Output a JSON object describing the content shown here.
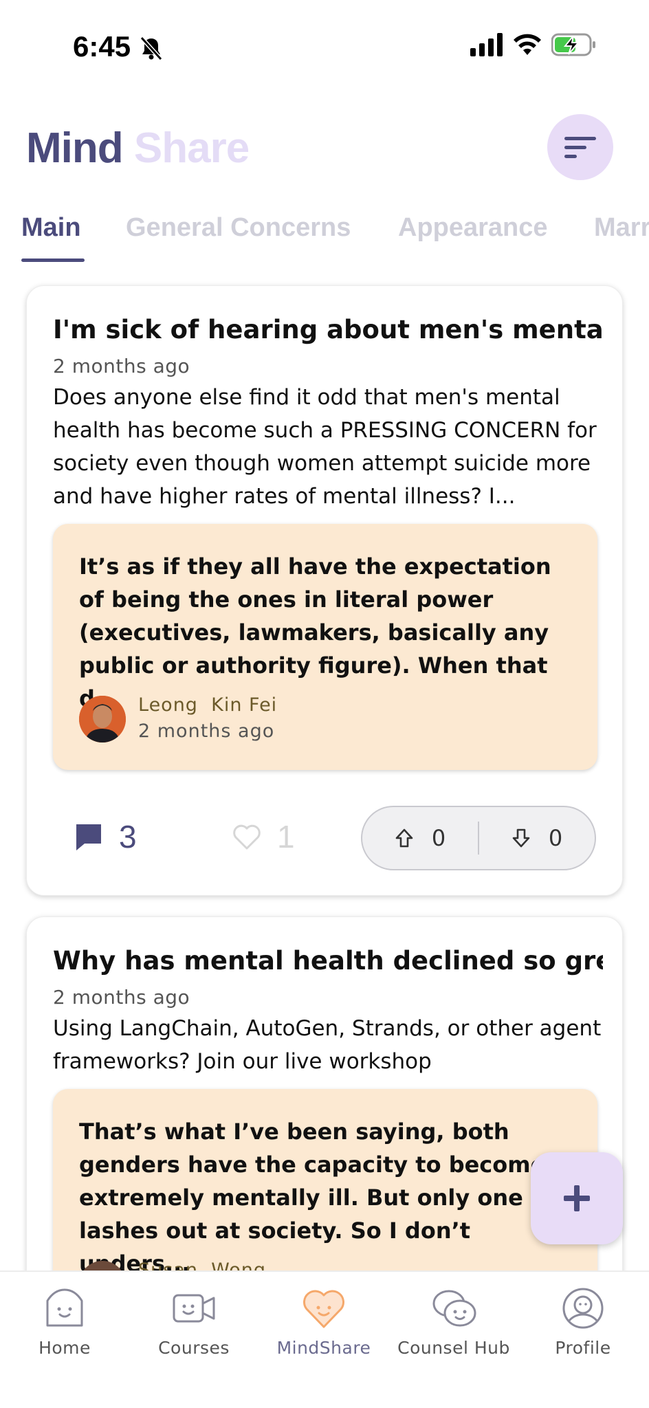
{
  "status_bar": {
    "time": "6:45",
    "icons": [
      "bell-slash-icon",
      "signal-icon",
      "wifi-icon",
      "battery-charging-icon"
    ]
  },
  "header": {
    "title_part1": "Mind",
    "title_part2": "Share",
    "filter_icon": "filter-lines-icon"
  },
  "tabs": [
    {
      "label": "Main",
      "active": true
    },
    {
      "label": "General Concerns",
      "active": false
    },
    {
      "label": "Appearance",
      "active": false
    },
    {
      "label": "Marr",
      "active": false
    }
  ],
  "posts": [
    {
      "title": "I'm sick of hearing about men's mental...",
      "time": "2 months ago",
      "body": "Does anyone else find it odd that men's mental health has become such a PRESSING CONCERN for society even though women attempt suicide more and have higher rates of mental illness? I...",
      "top_reply": {
        "text": "It’s as if they all have the expectation of being the ones in literal power (executives, lawmakers, basically any public or authority figure).  When that d...",
        "author": "Leong  Kin Fei",
        "time": "2 months ago"
      },
      "comments": "3",
      "likes": "1",
      "upvotes": "0",
      "downvotes": "0"
    },
    {
      "title": "Why has mental health declined so grea...",
      "time": "2 months ago",
      "body": "Using LangChain, AutoGen, Strands, or other agent frameworks? Join our live workshop",
      "top_reply": {
        "text": "That’s what I’ve been saying, both genders have the capacity to become extremely mentally ill. But only one lashes out at society. So I don’t unders...",
        "author": "Susan  Wong"
      }
    }
  ],
  "fab_icon": "plus-icon",
  "bottom_nav": [
    {
      "label": "Home",
      "icon": "home-icon",
      "active": false
    },
    {
      "label": "Courses",
      "icon": "video-camera-icon",
      "active": false
    },
    {
      "label": "MindShare",
      "icon": "heart-icon",
      "active": true
    },
    {
      "label": "Counsel Hub",
      "icon": "chat-bubbles-icon",
      "active": false
    },
    {
      "label": "Profile",
      "icon": "profile-icon",
      "active": false
    }
  ],
  "colors": {
    "brand": "#4b4b7c",
    "accent_light": "#e8dcf7",
    "reply_bg": "#fce9d2",
    "active_nav_icon": "#f5a86b"
  }
}
